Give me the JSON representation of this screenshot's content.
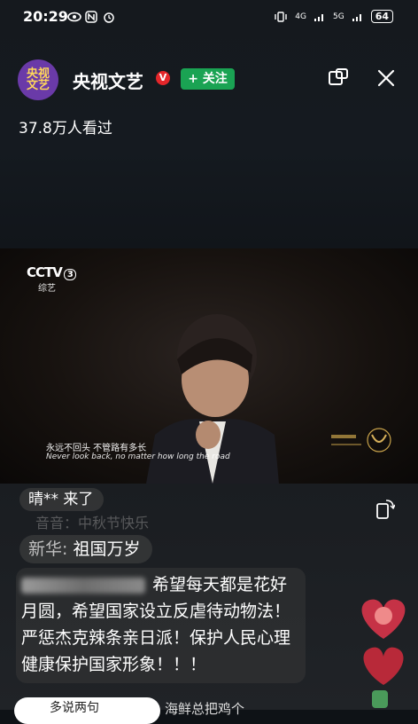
{
  "status_bar": {
    "time": "20:29",
    "network_1": "4G",
    "network_2": "5G",
    "battery": "64"
  },
  "header": {
    "avatar_text": "央视文艺",
    "channel_name": "央视文艺",
    "verified_badge": "V",
    "follow_label": "+ 关注",
    "views": "37.8万人看过"
  },
  "video": {
    "channel_logo": "CCTV",
    "channel_number": "3",
    "channel_sub": "综艺",
    "subtitle_cn": "永远不回头  不管路有多长",
    "subtitle_en": "Never look back, no matter how long the road"
  },
  "chat": {
    "join_message": "晴** 来了",
    "faded_message": "音音：中秋节快乐",
    "comment_user": "新华:",
    "comment_text": "祖国万岁",
    "long_comment": "希望每天都是花好月圆，希望国家设立反虐待动物法！严惩杰克辣条亲日派！保护人民心理健康保护国家形象！！！",
    "input_placeholder": "多说两句",
    "input_trailing": "海鲜总把鸡个"
  },
  "colors": {
    "follow_green": "#1aa353",
    "verified_red": "#e4262a",
    "avatar_purple": "#6a3aa8",
    "heart_red": "#d8344a"
  }
}
